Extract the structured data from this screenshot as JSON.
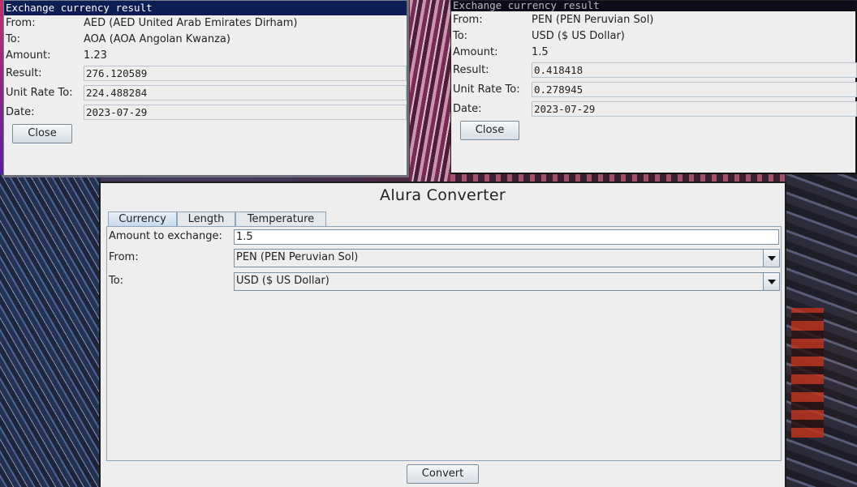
{
  "dialog_left": {
    "title": "Exchange currency result",
    "from_label": "From:",
    "from_value": "AED (AED United Arab Emirates Dirham)",
    "to_label": "To:",
    "to_value": "AOA (AOA Angolan Kwanza)",
    "amount_label": "Amount:",
    "amount_value": "1.23",
    "result_label": "Result:",
    "result_value": "276.120589",
    "unit_rate_label": "Unit Rate To:",
    "unit_rate_value": "224.488284",
    "date_label": "Date:",
    "date_value": "2023-07-29",
    "close_label": "Close"
  },
  "dialog_right": {
    "title": "Exchange currency result",
    "from_label": "From:",
    "from_value": "PEN (PEN Peruvian Sol)",
    "to_label": "To:",
    "to_value": "USD ($ US Dollar)",
    "amount_label": "Amount:",
    "amount_value": "1.5",
    "result_label": "Result:",
    "result_value": "0.418418",
    "unit_rate_label": "Unit Rate To:",
    "unit_rate_value": "0.278945",
    "date_label": "Date:",
    "date_value": "2023-07-29",
    "close_label": "Close"
  },
  "main": {
    "title": "Alura Converter",
    "tabs": [
      {
        "label": "Currency",
        "active": true
      },
      {
        "label": "Length",
        "active": false
      },
      {
        "label": "Temperature",
        "active": false
      }
    ],
    "amount_label": "Amount to exchange:",
    "amount_value": "1.5",
    "from_label": "From:",
    "from_selected": "PEN (PEN Peruvian Sol)",
    "to_label": "To:",
    "to_selected": "USD ($ US Dollar)",
    "convert_label": "Convert"
  },
  "colors": {
    "active_titlebar": "#0f1d55",
    "inactive_titlebar": "#0b0b1a",
    "window_bg": "#eeeeee",
    "border_accent": "#8fa4b8"
  }
}
